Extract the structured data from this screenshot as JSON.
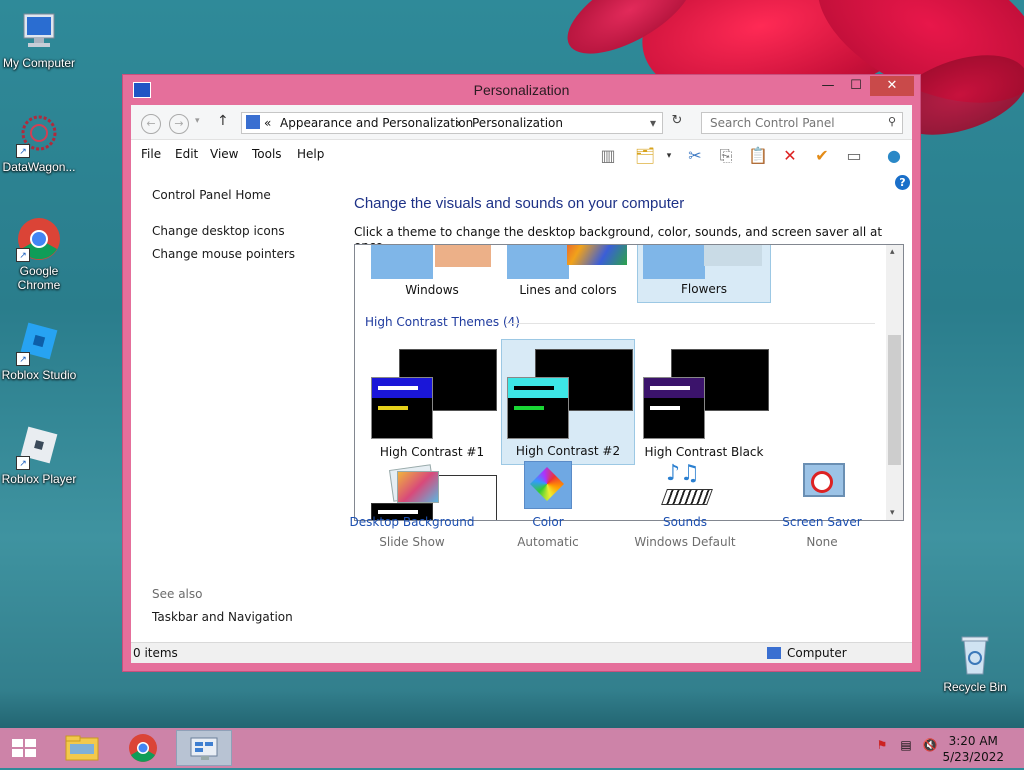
{
  "desktop": {
    "icons": [
      {
        "label": "My Computer"
      },
      {
        "label": "DataWagon..."
      },
      {
        "label": "Google Chrome"
      },
      {
        "label": "Roblox Studio"
      },
      {
        "label": "Roblox Player"
      },
      {
        "label": "Recycle Bin"
      }
    ]
  },
  "window": {
    "title": "Personalization",
    "breadcrumb": {
      "sep": "«",
      "part1": "Appearance and Personalization",
      "arrow": "›",
      "part2": "Personalization"
    },
    "search_placeholder": "Search Control Panel",
    "menu": [
      "File",
      "Edit",
      "View",
      "Tools",
      "Help"
    ],
    "sidebar": {
      "home": "Control Panel Home",
      "links": [
        "Change desktop icons",
        "Change mouse pointers"
      ],
      "see_also_title": "See also",
      "see_also": [
        "Taskbar and Navigation"
      ]
    },
    "heading": "Change the visuals and sounds on your computer",
    "subheading": "Click a theme to change the desktop background, color, sounds, and screen saver all at once.",
    "themes_top": [
      "Windows",
      "Lines and colors",
      "Flowers"
    ],
    "high_contrast_group": "High Contrast Themes (4)",
    "high_contrast": [
      "High Contrast #1",
      "High Contrast #2",
      "High Contrast Black"
    ],
    "bottom": [
      {
        "label": "Desktop Background",
        "value": "Slide Show"
      },
      {
        "label": "Color",
        "value": "Automatic"
      },
      {
        "label": "Sounds",
        "value": "Windows Default"
      },
      {
        "label": "Screen Saver",
        "value": "None"
      }
    ],
    "status_left": "0 items",
    "status_right": "Computer"
  },
  "clock": {
    "time": "3:20 AM",
    "date": "5/23/2022"
  }
}
